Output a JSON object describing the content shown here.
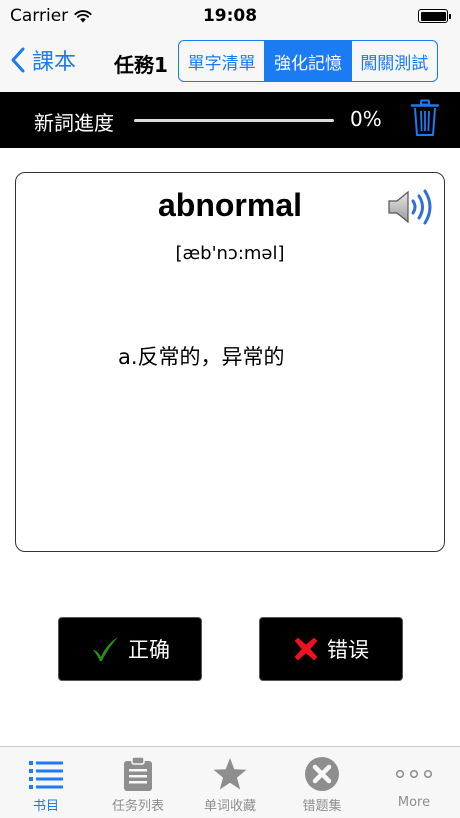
{
  "status_bar": {
    "carrier": "Carrier",
    "time": "19:08"
  },
  "nav": {
    "back_label": "課本",
    "title": "任務1",
    "segments": [
      {
        "label": "單字清單",
        "selected": false
      },
      {
        "label": "強化記憶",
        "selected": true
      },
      {
        "label": "闖關測試",
        "selected": false
      }
    ]
  },
  "progress": {
    "label": "新詞進度",
    "value_text": "0%",
    "value": 0
  },
  "card": {
    "word": "abnormal",
    "phonetic": "[æb'nɔ:məl]",
    "meaning": "a.反常的，异常的"
  },
  "answers": {
    "correct_label": "正确",
    "wrong_label": "错误"
  },
  "tabs": [
    {
      "label": "书目",
      "icon": "list-icon",
      "active": true
    },
    {
      "label": "任务列表",
      "icon": "clipboard-icon",
      "active": false
    },
    {
      "label": "单词收藏",
      "icon": "star-icon",
      "active": false
    },
    {
      "label": "错题集",
      "icon": "x-circle-icon",
      "active": false
    },
    {
      "label": "More",
      "icon": "more-icon",
      "active": false
    }
  ],
  "colors": {
    "accent": "#1a7bf2",
    "correct": "#2e8b1f",
    "wrong": "#ee1122",
    "tab_inactive": "#8e8e8e"
  }
}
